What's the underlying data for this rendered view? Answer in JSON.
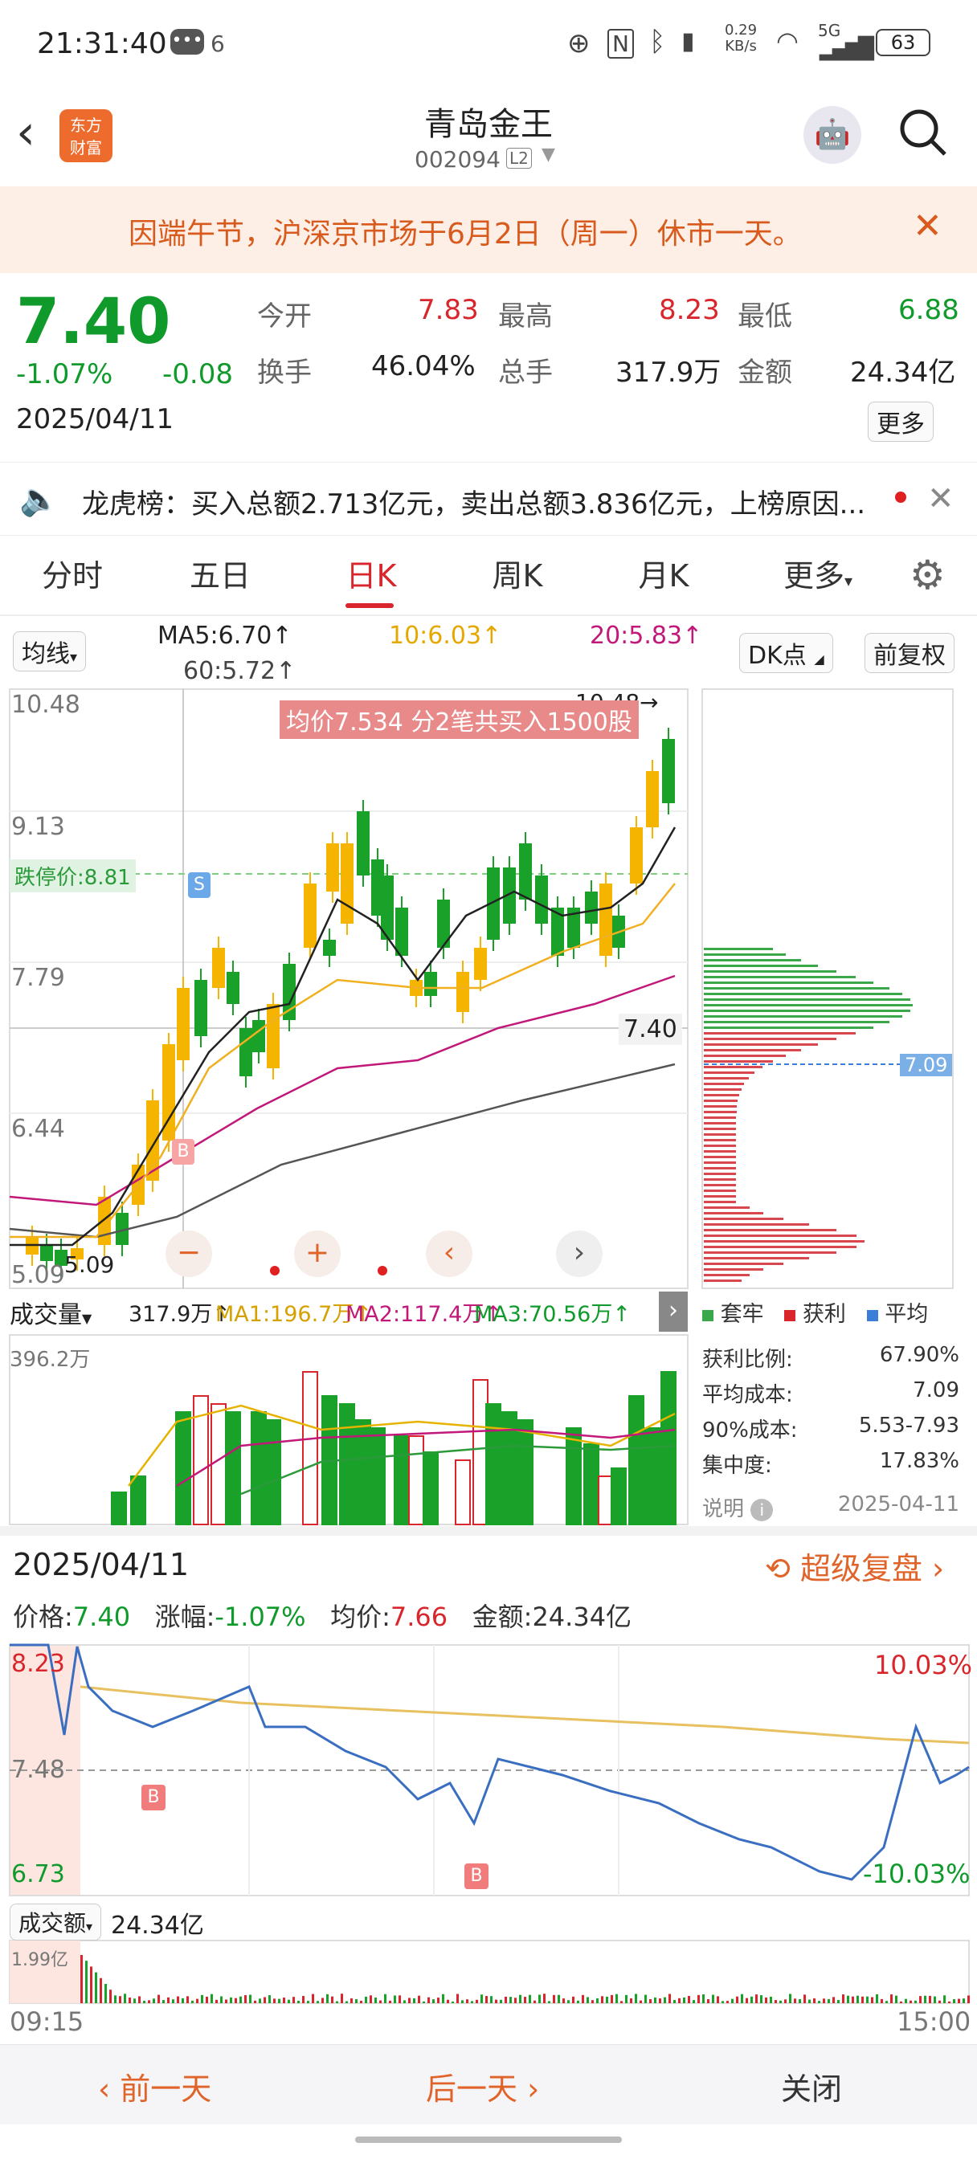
{
  "status_bar": {
    "time": "21:31:40",
    "notif_count": "6",
    "net_speed_top": "0.29",
    "net_speed_unit": "KB/s",
    "signal": "5G",
    "battery": "63"
  },
  "header": {
    "title": "青岛金王",
    "code": "002094",
    "level": "L2"
  },
  "notice": {
    "text": "因端午节，沪深京市场于6月2日（周一）休市一天。"
  },
  "quote": {
    "price": "7.40",
    "change_pct": "-1.07%",
    "change": "-0.08",
    "date": "2025/04/11",
    "open_label": "今开",
    "open": "7.83",
    "high_label": "最高",
    "high": "8.23",
    "low_label": "最低",
    "low": "6.88",
    "turnover_label": "换手",
    "turnover": "46.04%",
    "volume_label": "总手",
    "volume": "317.9万",
    "amount_label": "金额",
    "amount": "24.34亿",
    "more_button": "更多"
  },
  "lhb": {
    "text": "龙虎榜：买入总额2.713亿元，卖出总额3.836亿元，上榜原因..."
  },
  "tabs": [
    {
      "label": "分时"
    },
    {
      "label": "五日"
    },
    {
      "label": "日K"
    },
    {
      "label": "周K"
    },
    {
      "label": "月K"
    },
    {
      "label": "更多"
    }
  ],
  "kline": {
    "ma_type": "均线",
    "ma5": "MA5:6.70↑",
    "ma10": "10:6.03↑",
    "ma20": "20:5.83↑",
    "ma60": "60:5.72↑",
    "dk_button": "DK点",
    "fq_button": "前复权",
    "y_labels": [
      "10.48",
      "9.13",
      "7.79",
      "6.44",
      "5.09"
    ],
    "max_label": "10.48→",
    "min_label": "5.09",
    "limit_label": "跌停价:8.81",
    "tooltip": "均价7.534  分2笔共买入1500股",
    "current_price": "7.40",
    "cyq_price": "7.09",
    "colors": {
      "up": "#f5b400",
      "down": "#19a12a",
      "ma5": "#222222",
      "ma10": "#f0b020",
      "ma20": "#c2187a",
      "ma60": "#555555"
    }
  },
  "volume": {
    "label": "成交量",
    "total": "317.9万↑",
    "ma1": "MA1:196.7万↑",
    "ma2": "MA2:117.4万↑",
    "ma3": "MA3:70.56万↑",
    "max": "396.2万"
  },
  "cyq": {
    "legend": [
      "套牢",
      "获利",
      "平均"
    ],
    "rows": [
      {
        "label": "获利比例:",
        "value": "67.90%"
      },
      {
        "label": "平均成本:",
        "value": "7.09"
      },
      {
        "label": "90%成本:",
        "value": "5.53-7.93"
      },
      {
        "label": "集中度:",
        "value": "17.83%"
      }
    ],
    "note_label": "说明",
    "note_date": "2025-04-11"
  },
  "intraday": {
    "date": "2025/04/11",
    "replay": "超级复盘",
    "price_label": "价格:",
    "price": "7.40",
    "pct_label": "涨幅:",
    "pct": "-1.07%",
    "avg_label": "均价:",
    "avg": "7.66",
    "amt_label": "金额:",
    "amt": "24.34亿",
    "y_top": "8.23",
    "y_mid": "7.48",
    "y_bottom": "6.73",
    "pct_top": "10.03%",
    "pct_bottom": "-10.03%",
    "vol_label": "成交额",
    "vol_total": "24.34亿",
    "vol_max": "1.99亿",
    "time_start": "09:15",
    "time_end": "15:00"
  },
  "bottom": {
    "prev": "前一天",
    "next": "后一天",
    "close": "关闭"
  }
}
